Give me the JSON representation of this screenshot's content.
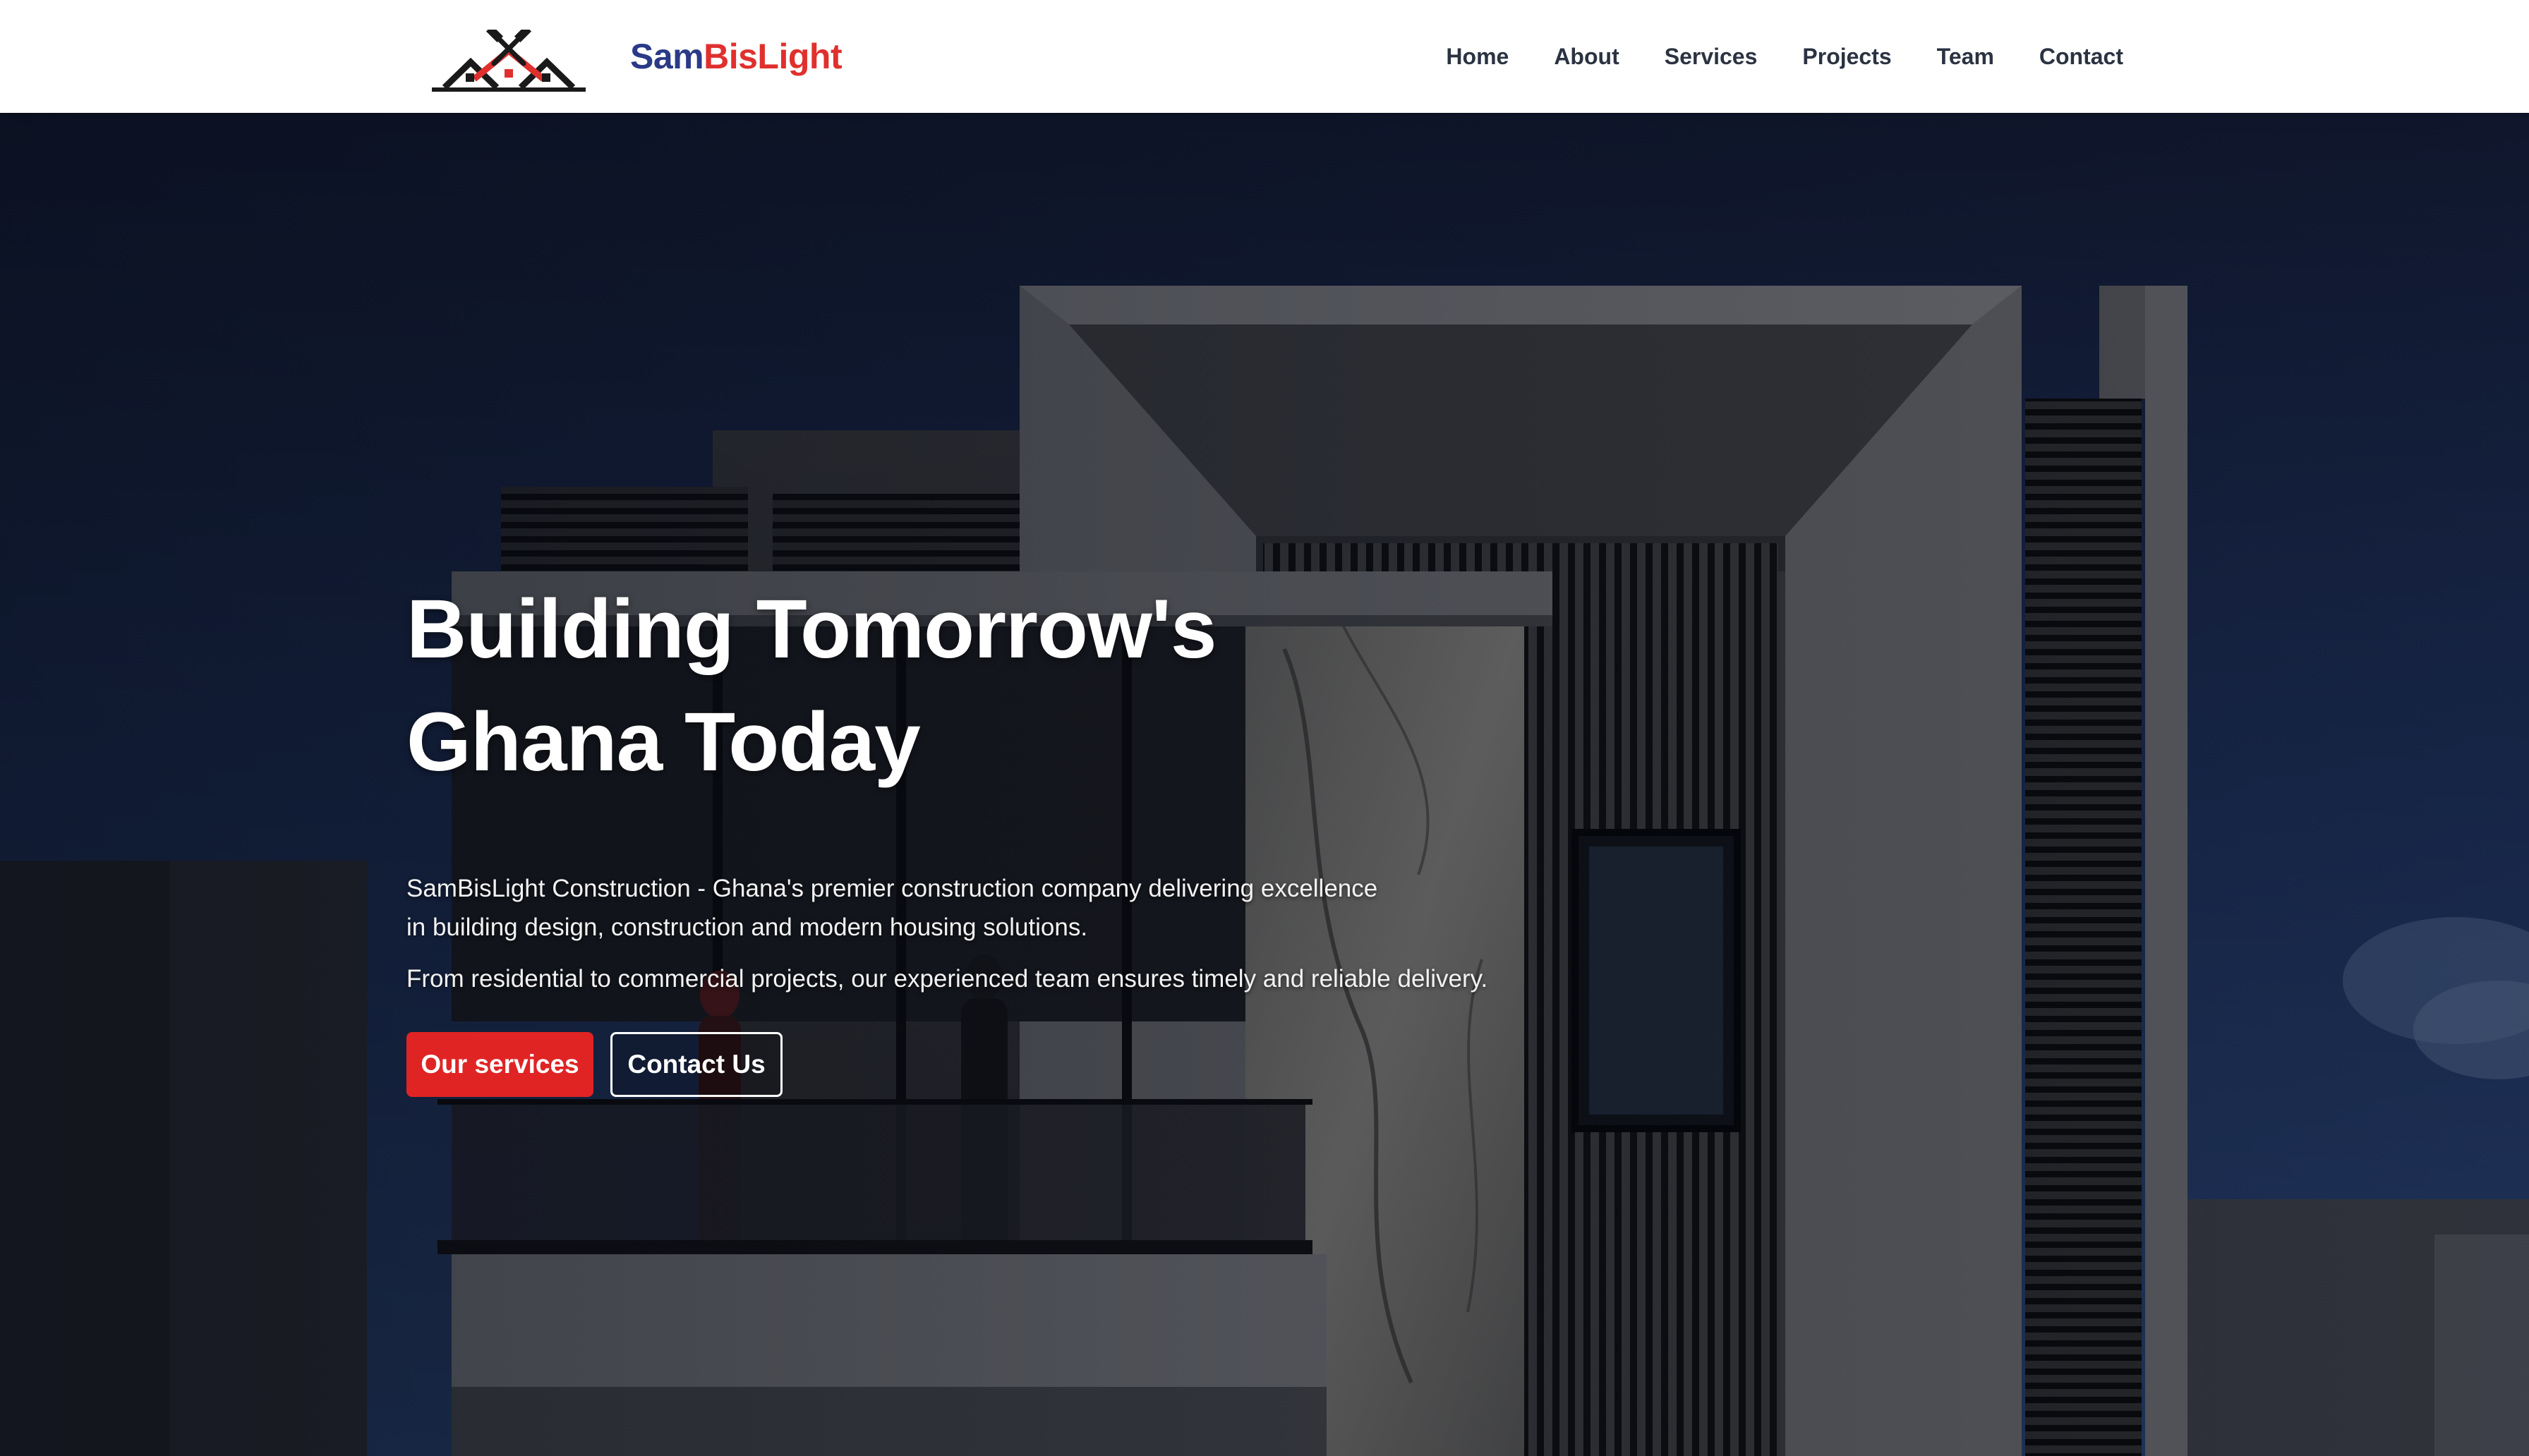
{
  "brand": {
    "part1": "Sam",
    "part2": "BisLight"
  },
  "nav": {
    "items": [
      {
        "label": "Home"
      },
      {
        "label": "About"
      },
      {
        "label": "Services"
      },
      {
        "label": "Projects"
      },
      {
        "label": "Team"
      },
      {
        "label": "Contact"
      }
    ]
  },
  "hero": {
    "title_line1": "Building Tomorrow's",
    "title_line2": "Ghana Today",
    "description": "SamBisLight Construction - Ghana's premier construction company delivering excellence in building design, construction and modern housing solutions.",
    "description2": "From residential to commercial projects, our experienced team ensures timely and reliable delivery.",
    "primary_button": "Our services",
    "secondary_button": "Contact Us"
  },
  "colors": {
    "brand_blue": "#2b3a87",
    "brand_red": "#e0302e",
    "primary_button": "#e02424",
    "nav_text": "#2b3342"
  }
}
